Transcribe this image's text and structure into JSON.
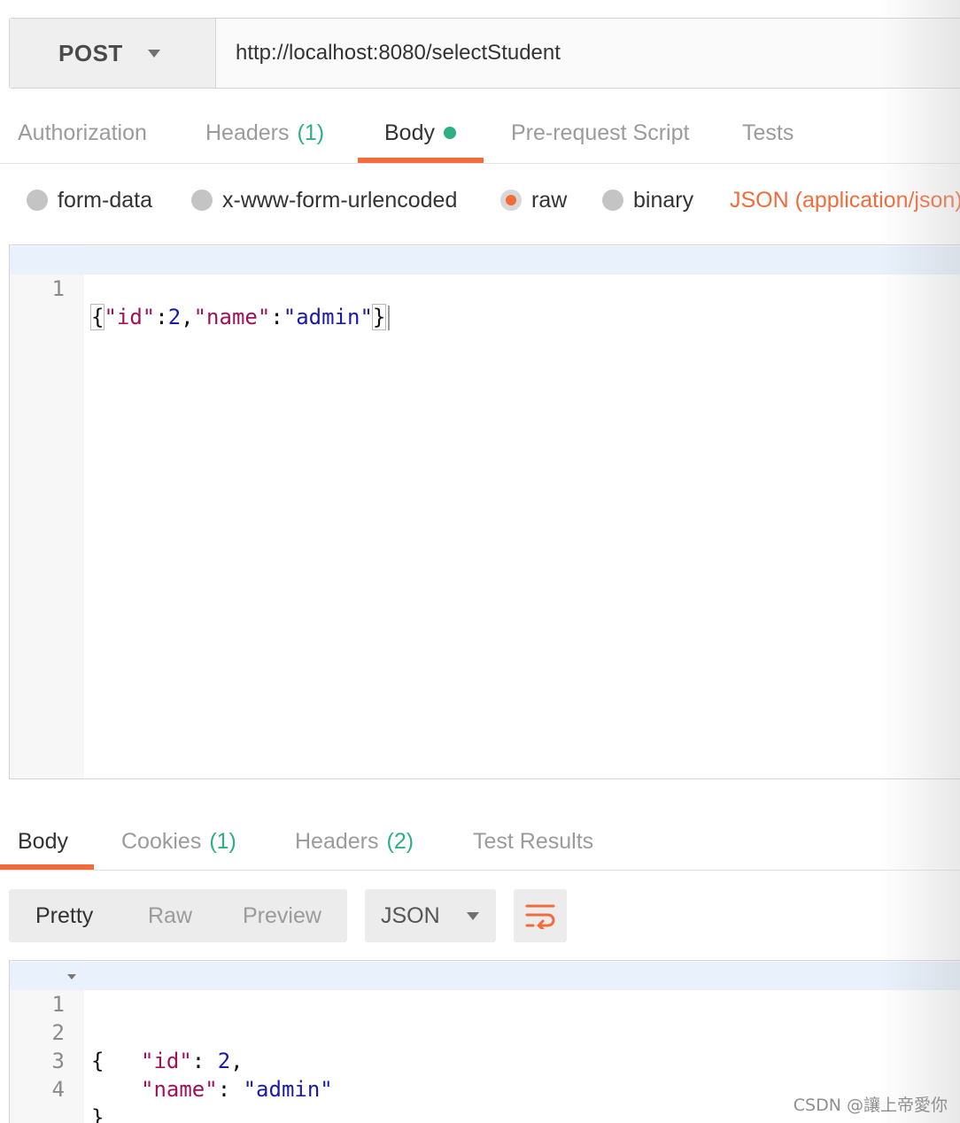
{
  "request": {
    "method": "POST",
    "url": "http://localhost:8080/selectStudent"
  },
  "request_tabs": {
    "authorization": "Authorization",
    "headers_label": "Headers",
    "headers_count": "(1)",
    "body": "Body",
    "prerequest": "Pre-request Script",
    "tests": "Tests"
  },
  "body_types": {
    "form_data": "form-data",
    "urlencoded": "x-www-form-urlencoded",
    "raw": "raw",
    "binary": "binary",
    "selected": "raw",
    "content_type": "JSON (application/json)"
  },
  "request_editor": {
    "line_numbers": [
      "1"
    ],
    "tokens": {
      "open": "{",
      "k1": "\"id\"",
      "colon1": ":",
      "v1": "2",
      "comma": ",",
      "k2": "\"name\"",
      "colon2": ":",
      "v2": "\"admin\"",
      "close": "}"
    }
  },
  "response_tabs": {
    "body": "Body",
    "cookies_label": "Cookies",
    "cookies_count": "(1)",
    "headers_label": "Headers",
    "headers_count": "(2)",
    "test_results": "Test Results"
  },
  "response_toolbar": {
    "pretty": "Pretty",
    "raw": "Raw",
    "preview": "Preview",
    "format": "JSON",
    "wrap_icon": "wrap-lines-icon"
  },
  "response_editor": {
    "line_numbers": [
      "1",
      "2",
      "3",
      "4"
    ],
    "open": "{",
    "key_id": "\"id\"",
    "val_id": "2",
    "key_name": "\"name\"",
    "val_name": "\"admin\"",
    "close": "}"
  },
  "watermark": "CSDN @讓上帝愛你",
  "colors": {
    "accent": "#f26b3a",
    "count_green": "#2bb180",
    "json_key": "#a0115a",
    "json_value": "#1a1aa6"
  }
}
